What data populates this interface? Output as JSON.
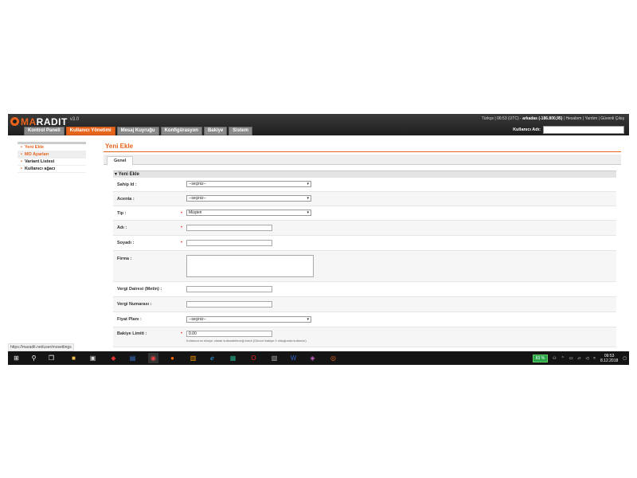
{
  "header": {
    "logo_part1": "MA",
    "logo_part2": "RADIT",
    "version": "v3.0",
    "top_info_prefix": "Türkçe | 06:53 (UTC) - ",
    "top_info_user": "arkadas (-186.800,95)",
    "top_info_suffix": " | Hesabım | Yardım | Güvenli Çıkış",
    "user_label": "Kullanıcı Adı:",
    "nav": [
      {
        "label": "Kontrol Paneli",
        "active": false
      },
      {
        "label": "Kullanıcı Yönetimi",
        "active": true
      },
      {
        "label": "Mesaj Kuyruğu",
        "active": false
      },
      {
        "label": "Konfigürasyon",
        "active": false
      },
      {
        "label": "Bakiye",
        "active": false
      },
      {
        "label": "Sistem",
        "active": false
      }
    ]
  },
  "sidebar": {
    "items": [
      {
        "label": "Yeni Ekle"
      },
      {
        "label": "MO Ayarları"
      },
      {
        "label": "Variant Listesi"
      },
      {
        "label": "Kullanıcı ağacı"
      }
    ]
  },
  "main": {
    "title": "Yeni Ekle",
    "tab": "Genel",
    "section_title": "▾ Yeni Ekle",
    "fields": {
      "sahip_id": {
        "label": "Sahip Id :",
        "value": "--seçiniz--"
      },
      "acenta": {
        "label": "Acenta :",
        "value": "--seçiniz--"
      },
      "tip": {
        "label": "Tip :",
        "value": "Müşteri"
      },
      "adi": {
        "label": "Adı :",
        "value": ""
      },
      "soyadi": {
        "label": "Soyadı :",
        "value": ""
      },
      "firma": {
        "label": "Firma :",
        "value": ""
      },
      "vergi_dairesi": {
        "label": "Vergi Dairesi (Metin) :",
        "value": ""
      },
      "vergi_numarasi": {
        "label": "Vergi Numarası :",
        "value": ""
      },
      "fiyat_plani": {
        "label": "Fiyat Planı :",
        "value": "--seçiniz--"
      },
      "bakiye_limiti": {
        "label": "Bakiye Limiti :",
        "value": "0.00",
        "hint": "Kullanıcının eksiye olarak kullanabileceği kredi (Güncel bakiye 0 olduğunda kullanılır)"
      }
    }
  },
  "status_url": "https://maradit.net/user/mosettings",
  "taskbar": {
    "battery": "83 %",
    "time": "09:53",
    "date": "8.12.2018"
  },
  "colors": {
    "accent": "#e8641b",
    "topbar": "#1e1e1e",
    "taskbar": "#141414"
  }
}
